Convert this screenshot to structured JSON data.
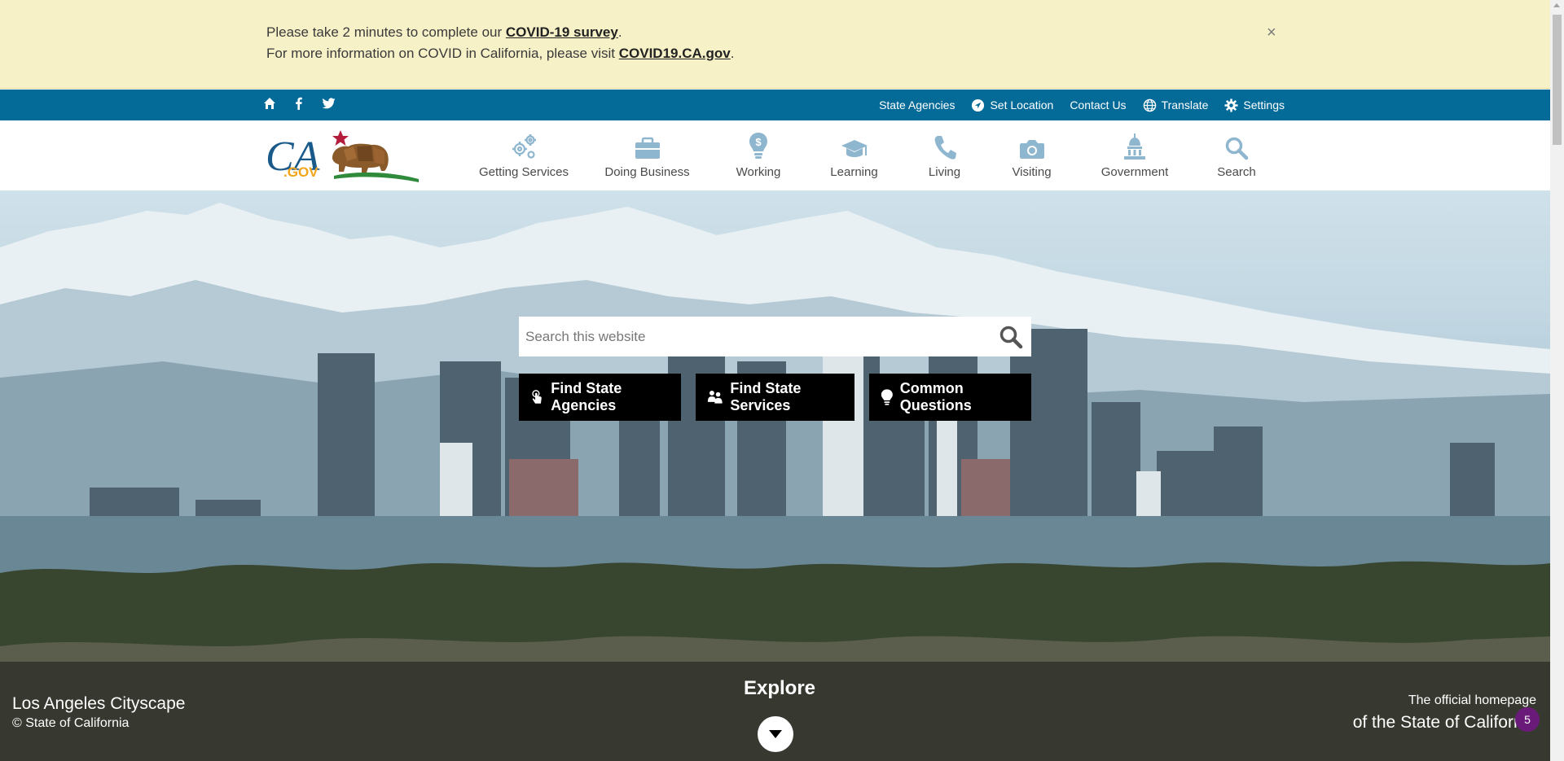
{
  "alert": {
    "line1_prefix": "Please take 2 minutes to complete our ",
    "line1_link": "COVID-19 survey",
    "line1_suffix": ".",
    "line2_prefix": "For more information on COVID in California, please visit ",
    "line2_link": "COVID19.CA.gov",
    "line2_suffix": ".",
    "close_label": "×"
  },
  "utility": {
    "social": [
      {
        "icon": "home-icon"
      },
      {
        "icon": "facebook-icon"
      },
      {
        "icon": "twitter-icon"
      }
    ],
    "links": {
      "state_agencies": "State Agencies",
      "set_location": "Set Location",
      "contact_us": "Contact Us",
      "translate": "Translate",
      "settings": "Settings"
    },
    "bg_color": "#046b99"
  },
  "logo": {
    "text_ca": "CA",
    "text_gov": ".GOV"
  },
  "nav": {
    "items": [
      {
        "label": "Getting Services",
        "icon": "gears-icon"
      },
      {
        "label": "Doing Business",
        "icon": "briefcase-icon"
      },
      {
        "label": "Working",
        "icon": "lightbulb-dollar-icon"
      },
      {
        "label": "Learning",
        "icon": "graduation-cap-icon"
      },
      {
        "label": "Living",
        "icon": "phone-icon"
      },
      {
        "label": "Visiting",
        "icon": "camera-icon"
      },
      {
        "label": "Government",
        "icon": "capitol-icon"
      },
      {
        "label": "Search",
        "icon": "search-icon"
      }
    ],
    "icon_color": "#8fb6cf"
  },
  "hero": {
    "search_placeholder": "Search this website",
    "buttons": {
      "agencies": "Find State Agencies",
      "services": "Find State Services",
      "questions": "Common Questions"
    },
    "caption_title": "Los Angeles Cityscape",
    "caption_credit": "© State of California",
    "explore_label": "Explore",
    "official_line1": "The official homepage",
    "official_line2": "of the State of California",
    "badge_count": "5"
  }
}
